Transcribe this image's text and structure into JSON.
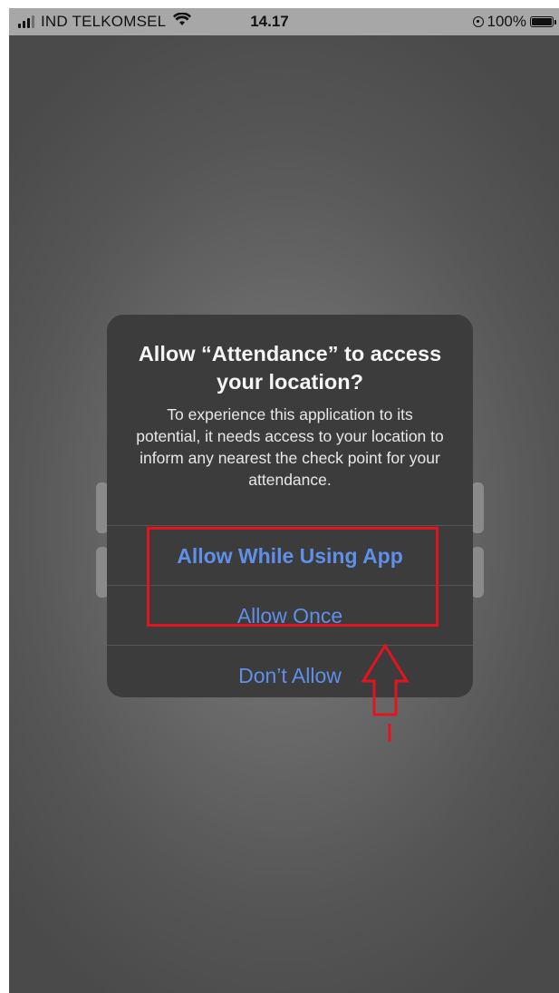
{
  "status_bar": {
    "carrier": "IND TELKOMSEL",
    "time": "14.17",
    "battery": "100%",
    "signal_bars": 4,
    "signal_bars_full": 3,
    "icons": [
      "signal-icon",
      "wifi-icon",
      "rotation-lock-icon",
      "battery-icon"
    ]
  },
  "alert": {
    "title": "Allow “Attendance” to access your location?",
    "message": "To experience this application to its potential, it needs access to your location to inform any nearest the check point  for your attendance.",
    "buttons": {
      "allow_while_using": "Allow While Using App",
      "allow_once": "Allow Once",
      "dont_allow": "Don’t Allow"
    }
  },
  "annotation": {
    "highlight_color": "#e4141e",
    "arrow_color": "#e4141e"
  },
  "colors": {
    "button_text": "#5f8fe8",
    "alert_background": "#3c3c3c",
    "status_bar_background": "#a7a7a7"
  }
}
